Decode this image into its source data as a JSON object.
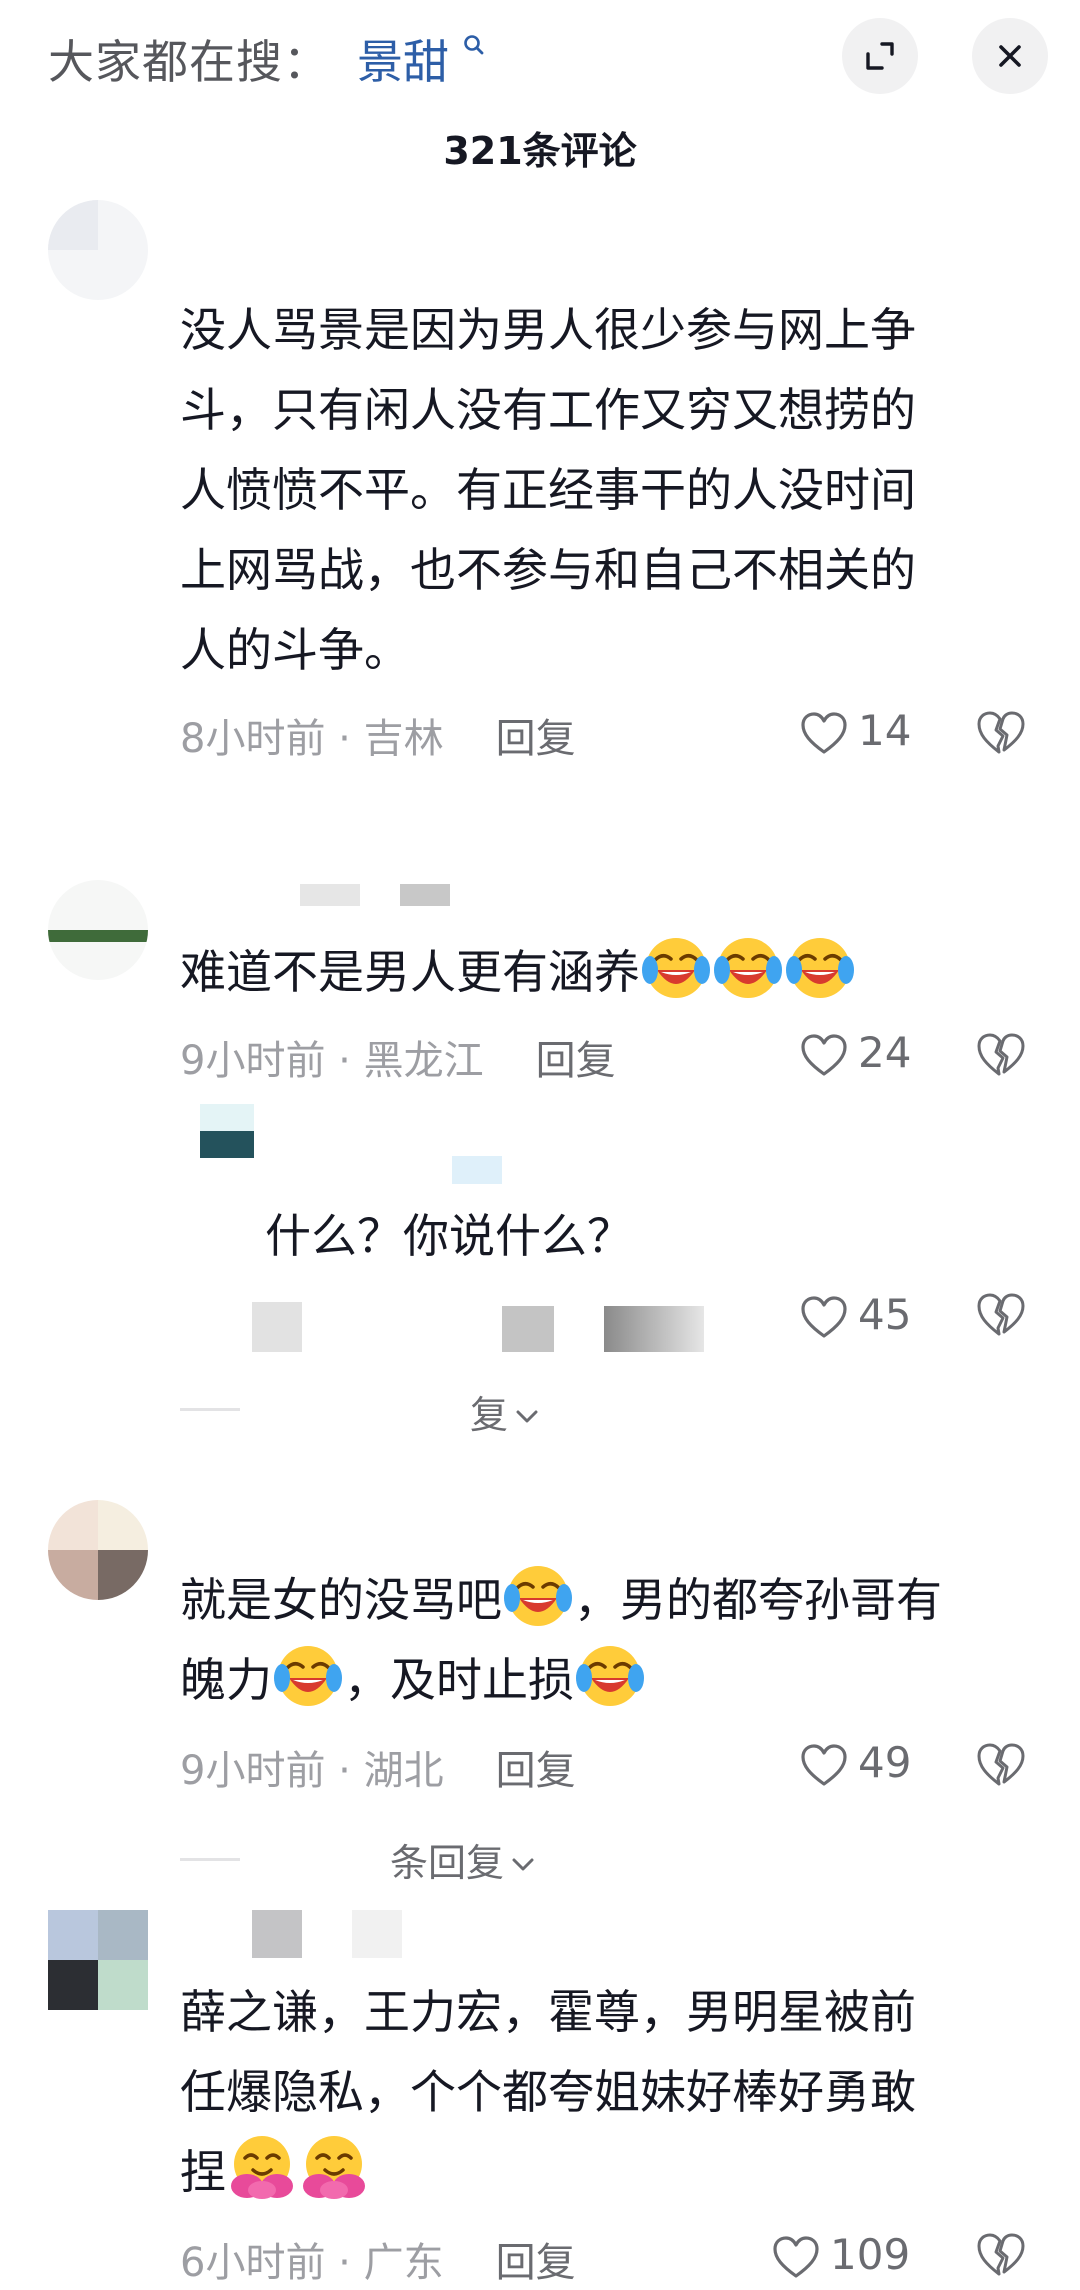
{
  "header": {
    "search_prefix": "大家都在搜：",
    "search_keyword": "景甜",
    "comment_count": "321条评论"
  },
  "comments": [
    {
      "lines": [
        "没人骂景是因为男人很少参与网上争",
        "斗，只有闲人没有工作又穷又想捞的",
        "人愤愤不平。有正经事干的人没时间",
        "上网骂战，也不参与和自己不相关的",
        "人的斗争。"
      ],
      "time": "8小时前",
      "location": "吉林",
      "reply_label": "回复",
      "likes": "14"
    },
    {
      "text": "难道不是男人更有涵养",
      "time": "9小时前",
      "location": "黑龙江",
      "reply_label": "回复",
      "likes": "24"
    },
    {
      "text": "什么？你说什么？",
      "likes": "45",
      "expand_label": "复"
    },
    {
      "line1": "就是女的没骂吧",
      "line1b": "，男的都夸孙哥有",
      "line2": "魄力",
      "line2b": "，及时止损",
      "time": "9小时前",
      "location": "湖北",
      "reply_label": "回复",
      "likes": "49",
      "expand_label": "条回复"
    },
    {
      "lines": [
        "薛之谦，王力宏，霍尊，男明星被前",
        "任爆隐私，个个都夸姐妹好棒好勇敢",
        "捏"
      ],
      "time": "6小时前",
      "location": "广东",
      "reply_label": "回复",
      "likes": "109"
    }
  ],
  "meta_separator": " · ",
  "icons": {
    "search": "search-icon",
    "expand": "expand-icon",
    "close": "close-icon",
    "like": "heart-icon",
    "dislike": "broken-heart-icon",
    "emoji_laugh_cry": "laugh-cry-emoji",
    "emoji_hug": "hug-emoji"
  },
  "colors": {
    "keyword": "#2d5ea7",
    "text": "#161823",
    "meta": "#9d9ea3",
    "emoji_yellow": "#ffcc3a"
  }
}
